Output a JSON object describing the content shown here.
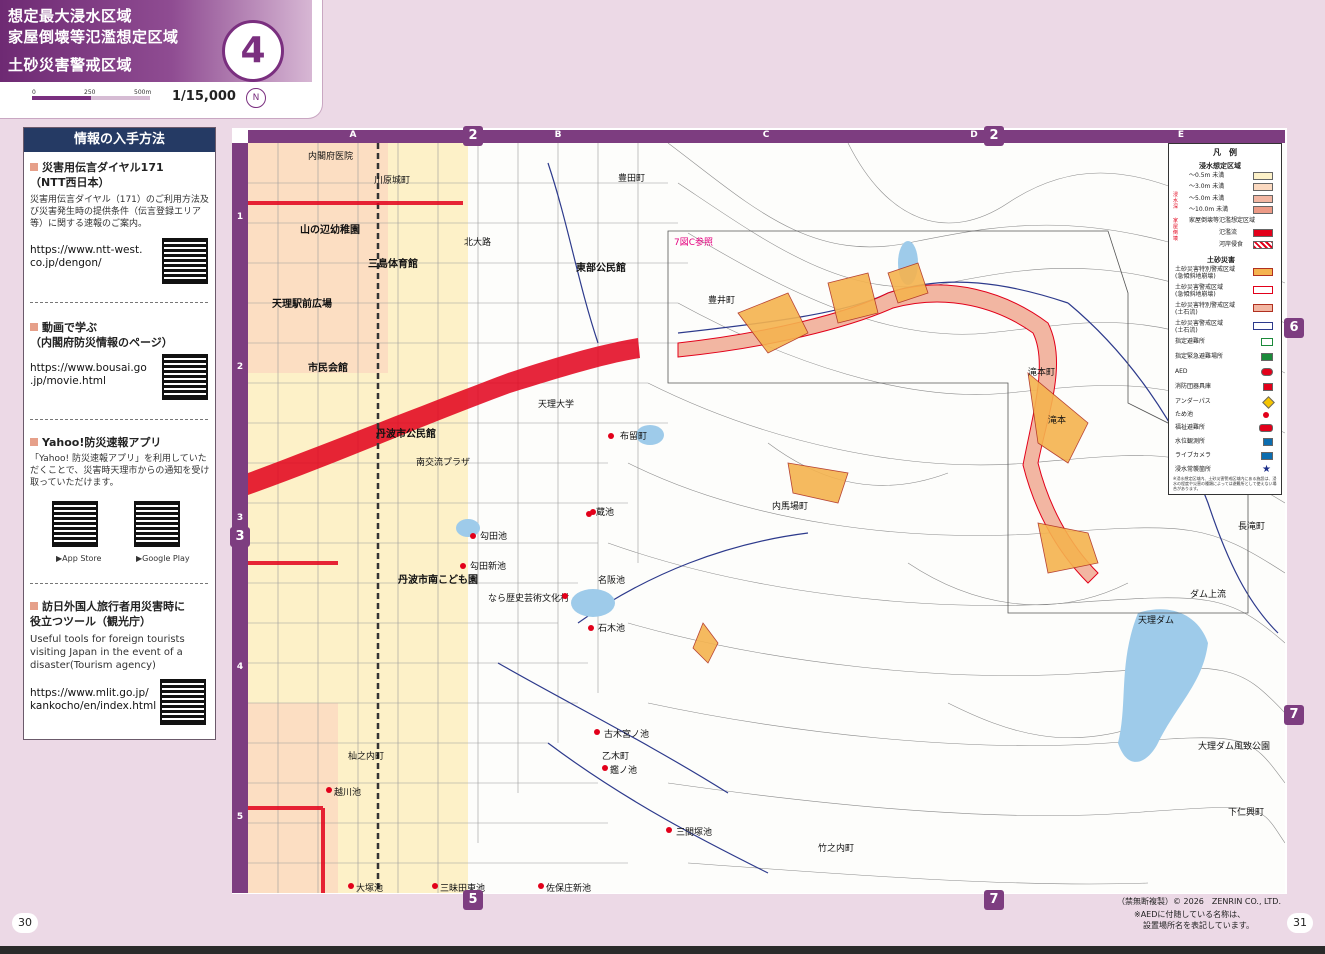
{
  "header": {
    "title_lines": [
      "想定最大浸水区域",
      "家屋倒壊等氾濫想定区域",
      "土砂災害警戒区域"
    ],
    "sheet_number": "4",
    "scale_ticks": [
      "0",
      "250",
      "500m"
    ],
    "scale": "1/15,000",
    "compass": "N"
  },
  "info": {
    "title": "情報の入手方法",
    "sections": [
      {
        "title": "災害用伝言ダイヤル171\n（NTT西日本）",
        "body": "災害用伝言ダイヤル（171）のご利用方法及び災害発生時の提供条件（伝言登録エリア等）に関する速報のご案内。",
        "url": "https://www.ntt-west.\nco.jp/dengon/"
      },
      {
        "title": "動画で学ぶ\n（内閣府防災情報のページ）",
        "url": "https://www.bousai.go\n.jp/movie.html"
      },
      {
        "title": "Yahoo!防災速報アプリ",
        "body": "「Yahoo! 防災速報アプリ」を利用していただくことで、災害時天理市からの通知を受け取っていただけます。",
        "qr_labels": [
          "▶App Store",
          "▶Google Play"
        ]
      },
      {
        "title": "訪日外国人旅行者用災害時に\n役立つツール（観光庁）",
        "body": "Useful tools for foreign tourists visiting Japan in the event of a disaster(Tourism agency)",
        "url": "https://www.mlit.go.jp/\nkankocho/en/index.html"
      }
    ]
  },
  "grid": {
    "columns": [
      "A",
      "B",
      "C",
      "D",
      "E"
    ],
    "rows": [
      "1",
      "2",
      "3",
      "4",
      "5"
    ],
    "adjacent_sheets": {
      "top_b": "2",
      "top_d": "2",
      "left_3": "3",
      "right_6": "6",
      "right_7": "7",
      "bottom_5": "5",
      "bottom_7": "7"
    }
  },
  "legend": {
    "title": "凡　例",
    "flood_title": "浸水想定区域",
    "flood_items": [
      "～0.5m 未満",
      "～3.0m 未満",
      "～5.0m 未満",
      "～10.0m 未満",
      "家屋倒壊等氾濫想定区域"
    ],
    "flood_side_labels": [
      "浸水深",
      "家屋倒壊"
    ],
    "flood_sub": [
      "氾濫流",
      "河岸侵食"
    ],
    "sediment_title": "土砂災害",
    "sediment_items": [
      "土砂災害特別警戒区域\n(急傾斜地崩壊)",
      "土砂災害警戒区域\n(急傾斜地崩壊)",
      "土砂災害特別警戒区域\n(土石流)",
      "土砂災害警戒区域\n(土石流)"
    ],
    "facility_items": [
      "指定避難所",
      "指定緊急避難場所",
      "AED",
      "消防団器具庫",
      "アンダーパス",
      "ため池",
      "福祉避難所",
      "水位観測所",
      "ライブカメラ",
      "浸水常襲箇所"
    ],
    "footnote": "※浸水想定区域内、土砂災害警戒区域内にある施設は、浸水の程度や災害の種類によっては避難所として使えない場合があります。"
  },
  "map_labels": {
    "places": [
      "内閣府医院",
      "山の辺幼稚園",
      "三島体育館",
      "東部公民館",
      "天理駅前広場",
      "市民会館",
      "丹波市公民館",
      "南交流プラザ",
      "丹波市南こども園",
      "布留町",
      "豊井町",
      "天理大学",
      "滝本町",
      "滝本",
      "内馬場町",
      "勾田池",
      "勾田新池",
      "名阪池",
      "石木池",
      "蔵池",
      "古木宮ノ池",
      "乙木町",
      "鑑ノ池",
      "三間塚池",
      "竹之内町",
      "越川池",
      "大塚池",
      "三昧田東池",
      "佐保庄新池",
      "天理ダム",
      "長滝町",
      "ダム上流",
      "なら歴史芸術文化村",
      "大理ダム風致公園",
      "下仁興町",
      "7図C参照",
      "杣之内町",
      "川原城町",
      "豊田町",
      "北大路"
    ],
    "tameike_dots": 14
  },
  "footer": {
    "page_left": "30",
    "page_right": "31",
    "copyright": "（禁無断複製）© 2026　ZENRIN CO., LTD.",
    "note_line1": "※AEDに付随している名称は、",
    "note_line2": "設置場所名を表記しています。"
  },
  "colors": {
    "accent": "#7d3d80",
    "panel_head": "#253a64",
    "flood_shallow": "#fdf1c8",
    "flood_mid": "#fbd9c0",
    "flood_deep": "#f2b6a2",
    "collapse_red": "#e2001a",
    "sediment_orange": "#f5b34f",
    "water_blue": "#9ecbea"
  }
}
